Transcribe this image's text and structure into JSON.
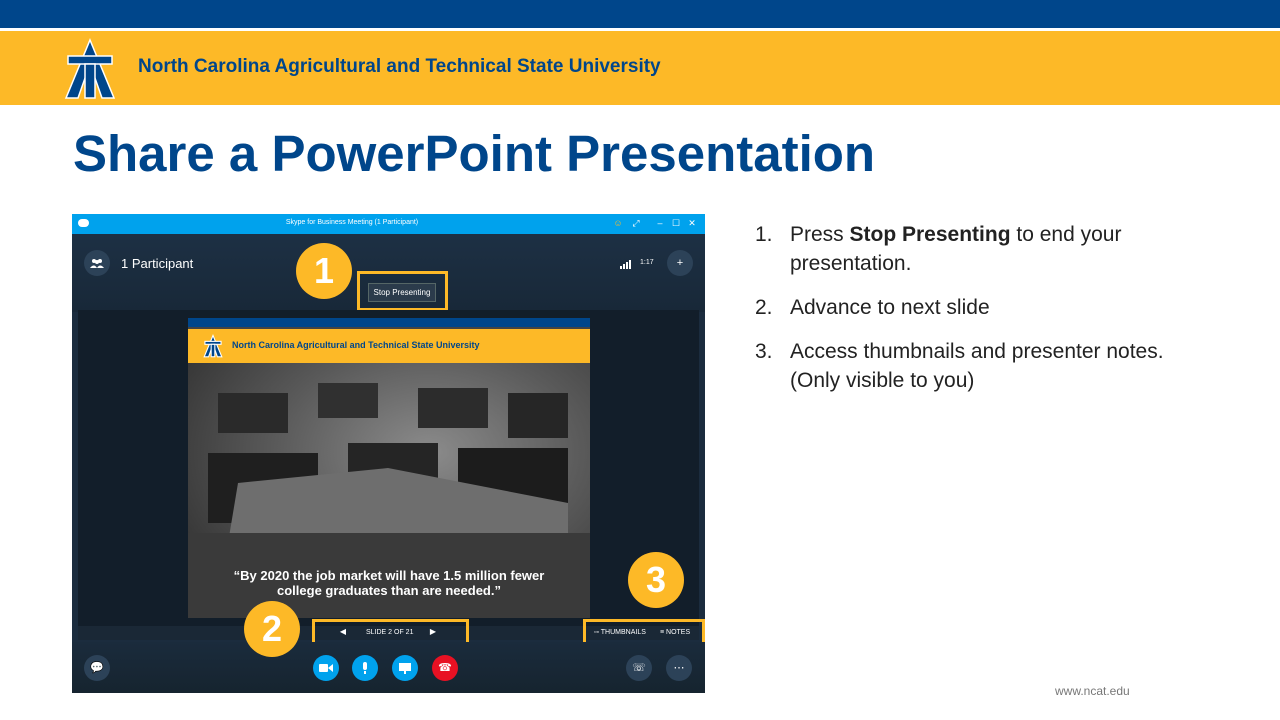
{
  "header": {
    "university_name": "North Carolina Agricultural and Technical State University",
    "brand_navy": "#00468b",
    "brand_gold": "#fdb927"
  },
  "title": "Share a PowerPoint Presentation",
  "screenshot": {
    "window_title": "Skype for Business Meeting (1 Participant)",
    "participants_label": "1 Participant",
    "clock": "1:17",
    "stop_presenting": "Stop Presenting",
    "slide": {
      "university_name": "North Carolina Agricultural and Technical State University",
      "quote_line1": "“By 2020 the job market will have 1.5 million fewer",
      "quote_line2": "college graduates than are needed.”"
    },
    "slide_counter": "SLIDE 2 OF 21",
    "thumbnails_label": "THUMBNAILS",
    "notes_label": "NOTES"
  },
  "badges": [
    "1",
    "2",
    "3"
  ],
  "steps": [
    {
      "num": "1.",
      "pre": "Press ",
      "bold": "Stop Presenting",
      "post": " to end your presentation."
    },
    {
      "num": "2.",
      "text": "Advance to next slide"
    },
    {
      "num": "3.",
      "text": "Access thumbnails and presenter notes. (Only visible to you)"
    }
  ],
  "footer": {
    "url": "www.ncat.edu"
  }
}
